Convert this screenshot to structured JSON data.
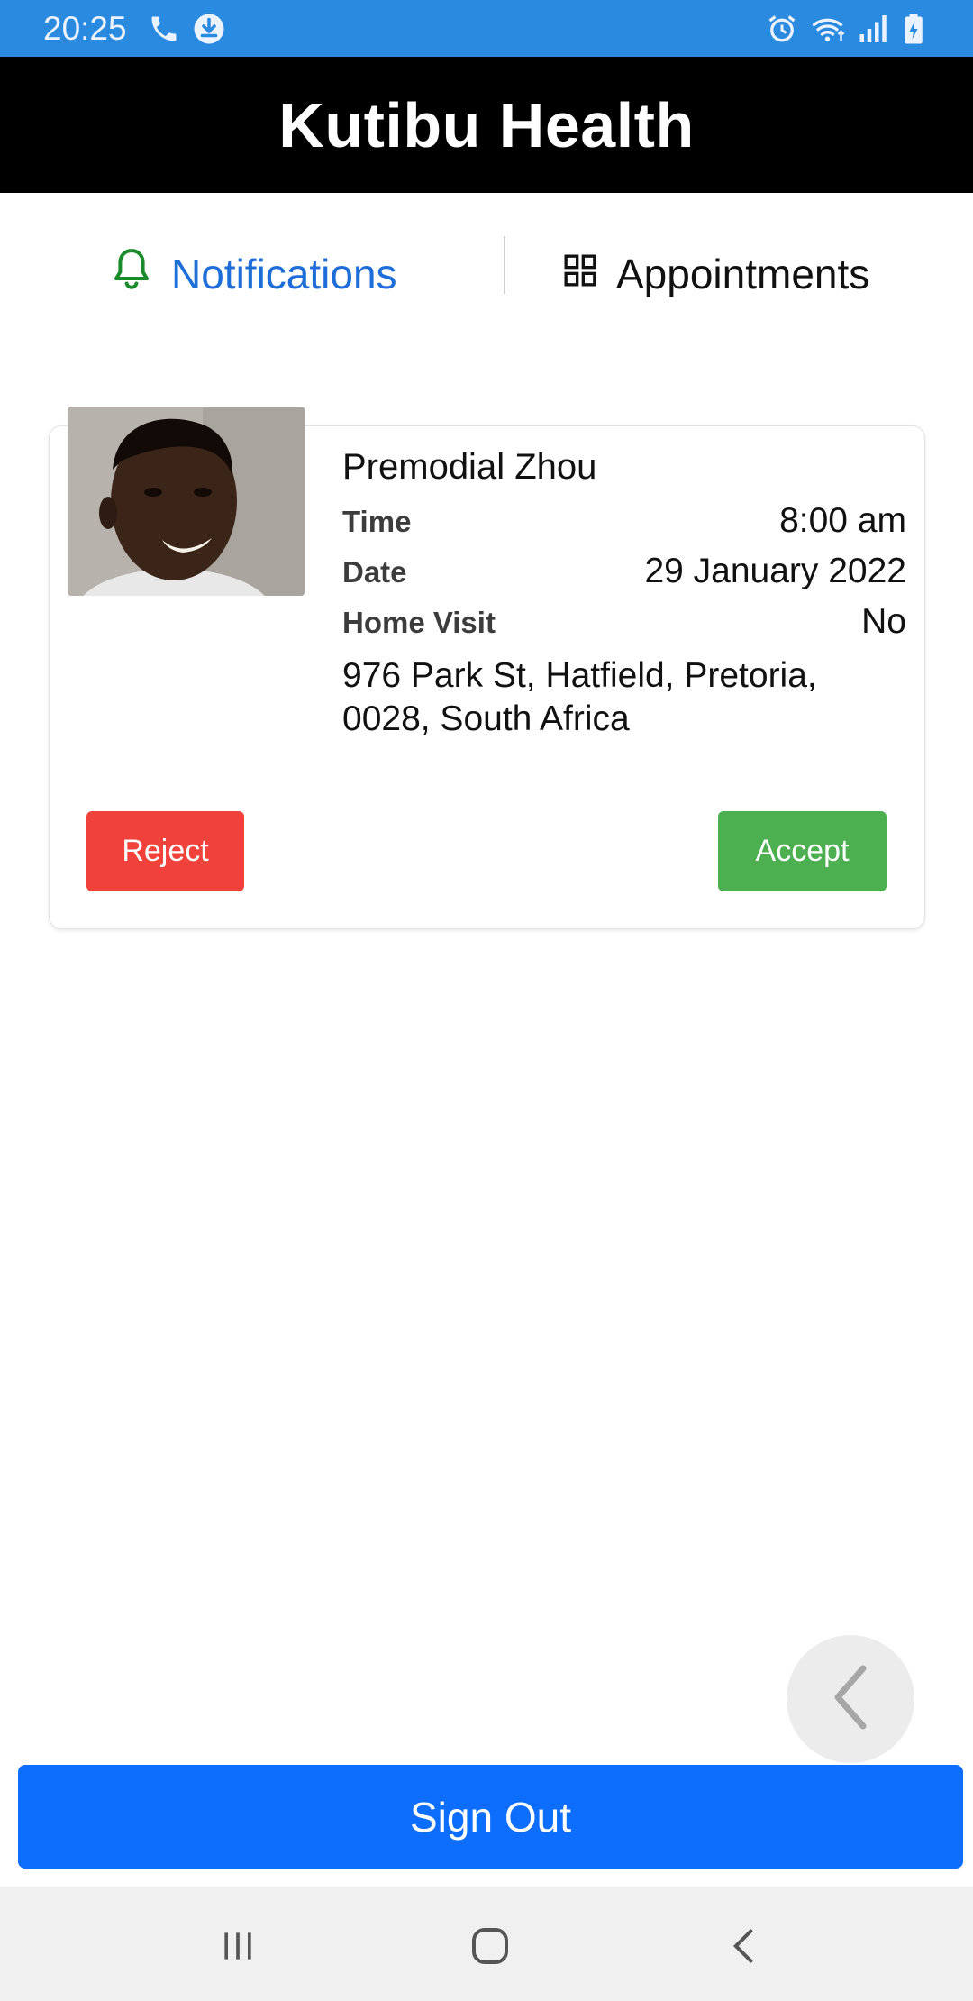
{
  "status_bar": {
    "time": "20:25",
    "left_icons": [
      "phone-icon",
      "download-icon"
    ],
    "right_icons": [
      "alarm-icon",
      "wifi-icon",
      "signal-icon",
      "battery-charging-icon"
    ],
    "background": "#2a8ae0"
  },
  "header": {
    "title": "Kutibu Health",
    "background": "#000000"
  },
  "tabs": [
    {
      "label": "Notifications",
      "icon": "bell-icon",
      "active": true,
      "color": "#1d6ed8"
    },
    {
      "label": "Appointments",
      "icon": "grid-icon",
      "active": false,
      "color": "#111111"
    }
  ],
  "request": {
    "patient_name": "Premodial Zhou",
    "time_label": "Time",
    "time_value": "8:00 am",
    "date_label": "Date",
    "date_value": "29 January 2022",
    "home_visit_label": "Home Visit",
    "home_visit_value": "No",
    "address": "976 Park St, Hatfield, Pretoria, 0028, South Africa",
    "reject_label": "Reject",
    "accept_label": "Accept",
    "reject_color": "#f0413a",
    "accept_color": "#4caf50"
  },
  "sign_out_label": "Sign Out",
  "system_nav": [
    "recent-apps-icon",
    "home-icon",
    "back-icon"
  ]
}
